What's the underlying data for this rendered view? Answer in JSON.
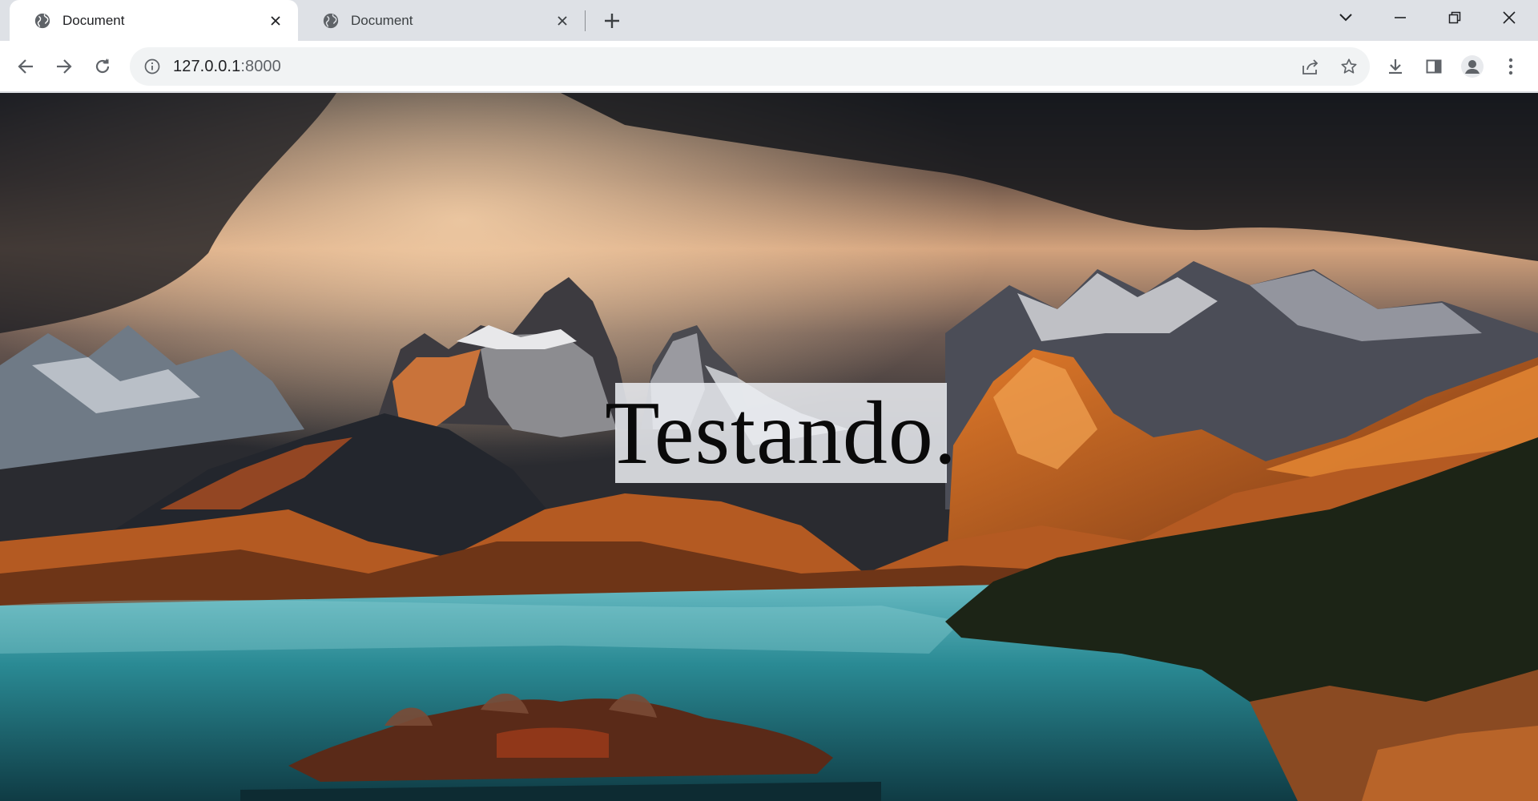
{
  "browser": {
    "tabs": [
      {
        "title": "Document",
        "active": true
      },
      {
        "title": "Document",
        "active": false
      }
    ],
    "new_tab_icon": "plus-icon",
    "window_controls": [
      "chevron-down-icon",
      "minimize-icon",
      "restore-icon",
      "close-icon"
    ],
    "address_bar": {
      "host": "127.0.0.1",
      "port": ":8000",
      "info_icon": "info-icon"
    },
    "toolbar_icons": [
      "back-arrow-icon",
      "forward-arrow-icon",
      "reload-icon",
      "share-icon",
      "bookmark-star-icon",
      "download-icon",
      "side-panel-icon",
      "profile-avatar-icon",
      "kebab-menu-icon"
    ]
  },
  "page": {
    "headline": "Testando.",
    "background_description_icon": "mountain-lake-landscape-image"
  },
  "colors": {
    "tabstrip_bg": "#dee1e6",
    "toolbar_bg": "#ffffff",
    "omnibox_bg": "#f1f3f4",
    "headline_box_bg": "#ebeef2"
  }
}
